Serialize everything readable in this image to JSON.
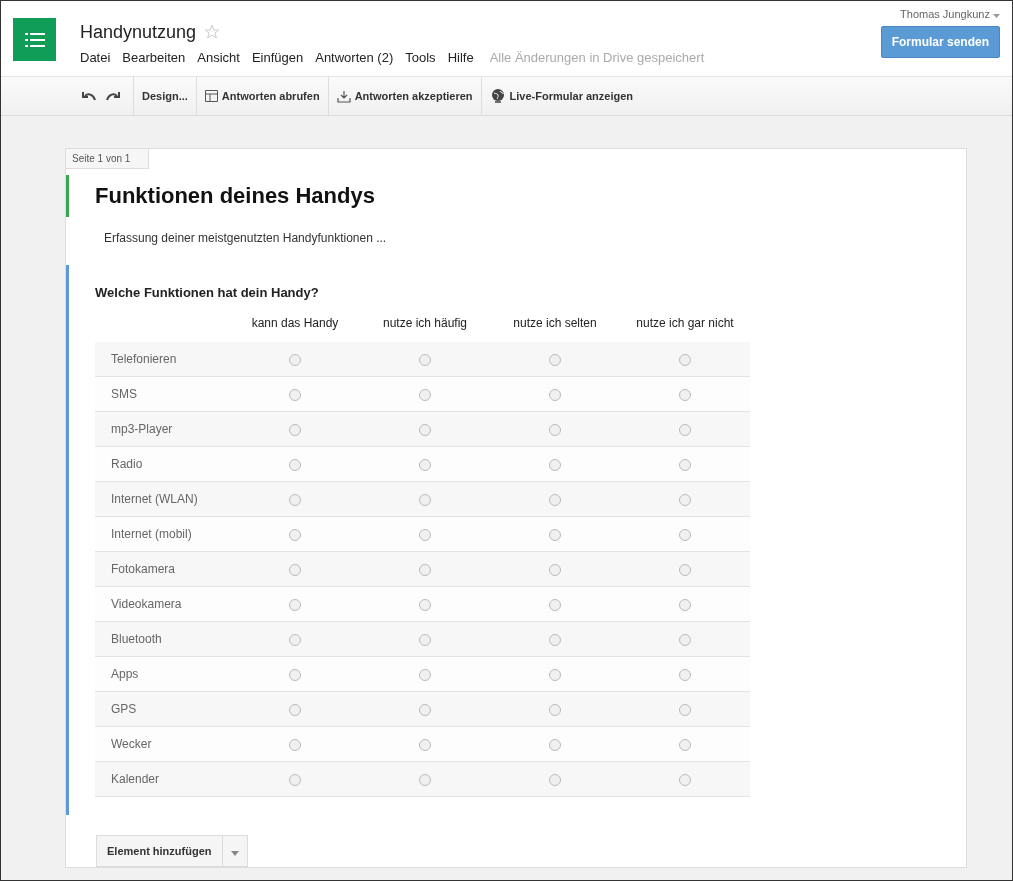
{
  "header": {
    "title": "Handynutzung",
    "starred": false,
    "menu": [
      "Datei",
      "Bearbeiten",
      "Ansicht",
      "Einfügen",
      "Antworten (2)",
      "Tools",
      "Hilfe"
    ],
    "save_status": "Alle Änderungen in Drive gespeichert",
    "user": "Thomas Jungkunz",
    "send_button": "Formular senden"
  },
  "toolbar": [
    {
      "kind": "undo"
    },
    {
      "kind": "redo"
    },
    {
      "kind": "text",
      "label": "Design..."
    },
    {
      "kind": "table",
      "label": "Antworten abrufen"
    },
    {
      "kind": "download",
      "label": "Antworten akzeptieren"
    },
    {
      "kind": "globe",
      "label": "Live-Formular anzeigen"
    }
  ],
  "form": {
    "page_tab": "Seite 1 von 1",
    "title": "Funktionen deines Handys",
    "description": "Erfassung deiner meistgenutzten Handyfunktionen ...",
    "question": {
      "title": "Welche Funktionen hat dein Handy?",
      "columns": [
        "kann das Handy",
        "nutze ich häufig",
        "nutze ich selten",
        "nutze ich gar nicht"
      ],
      "rows": [
        {
          "label": "Telefonieren",
          "choices": [
            false,
            false,
            false,
            false
          ]
        },
        {
          "label": "SMS",
          "choices": [
            false,
            false,
            false,
            false
          ]
        },
        {
          "label": "mp3-Player",
          "choices": [
            false,
            false,
            false,
            false
          ]
        },
        {
          "label": "Radio",
          "choices": [
            false,
            false,
            false,
            false
          ]
        },
        {
          "label": "Internet (WLAN)",
          "choices": [
            false,
            false,
            false,
            false
          ]
        },
        {
          "label": "Internet (mobil)",
          "choices": [
            false,
            false,
            false,
            false
          ]
        },
        {
          "label": "Fotokamera",
          "choices": [
            false,
            false,
            false,
            false
          ]
        },
        {
          "label": "Videokamera",
          "choices": [
            false,
            false,
            false,
            false
          ]
        },
        {
          "label": "Bluetooth",
          "choices": [
            false,
            false,
            false,
            false
          ]
        },
        {
          "label": "Apps",
          "choices": [
            false,
            false,
            false,
            false
          ]
        },
        {
          "label": "GPS",
          "choices": [
            false,
            false,
            false,
            false
          ]
        },
        {
          "label": "Wecker",
          "choices": [
            false,
            false,
            false,
            false
          ]
        },
        {
          "label": "Kalender",
          "choices": [
            false,
            false,
            false,
            false
          ]
        }
      ]
    },
    "add_button": "Element hinzufügen"
  }
}
